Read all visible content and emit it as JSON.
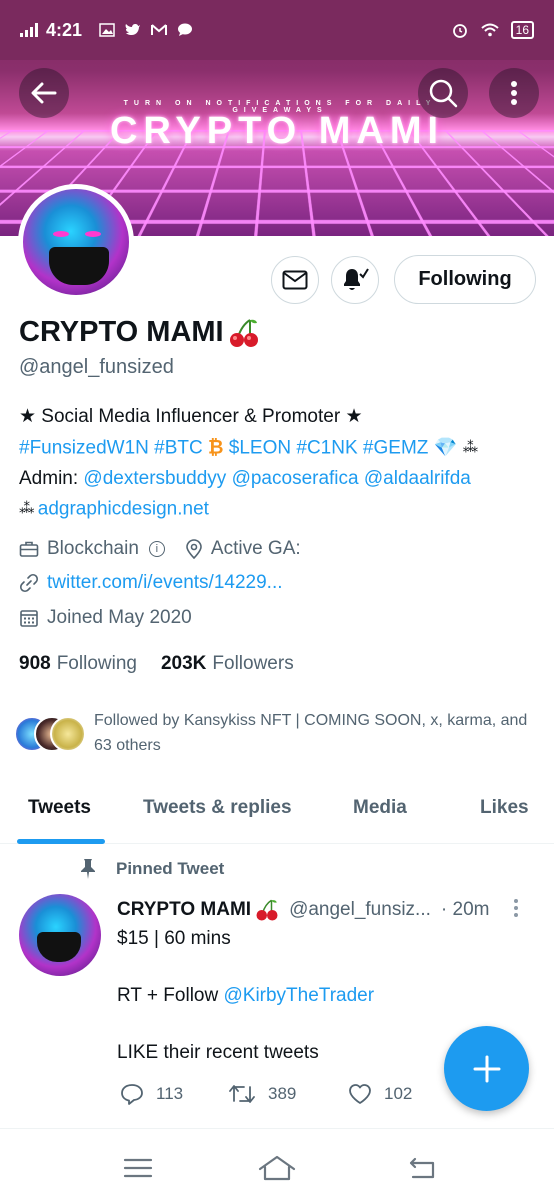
{
  "status_bar": {
    "time": "4:21",
    "battery": "16"
  },
  "banner": {
    "small_text": "TURN ON NOTIFICATIONS FOR DAILY GIVEAWAYS",
    "title": "CRYPTO MAMI"
  },
  "profile": {
    "name": "CRYPTO MAMI",
    "handle": "@angel_funsized",
    "follow_label": "Following",
    "bio_line1": "★ Social Media Influencer & Promoter ★",
    "bio_tags": [
      "#FunsizedW1N",
      "#BTC",
      "$LEON",
      "#C1NK",
      "#GEMZ"
    ],
    "bio_admin_label": "Admin:",
    "bio_admins": [
      "@dextersbuddyy",
      "@pacoserafica",
      "@aldaalrifda"
    ],
    "bio_site": "adgraphicdesign.net",
    "category": "Blockchain",
    "location": "Active GA:",
    "url": "twitter.com/i/events/14229...",
    "joined": "Joined May 2020",
    "following_count": "908",
    "following_label": "Following",
    "followers_count": "203K",
    "followers_label": "Followers",
    "followed_by": "Followed by Kansykiss NFT | COMING SOON, x, karma, and 63 others"
  },
  "tabs": [
    {
      "label": "Tweets",
      "active": true
    },
    {
      "label": "Tweets & replies",
      "active": false
    },
    {
      "label": "Media",
      "active": false
    },
    {
      "label": "Likes",
      "active": false
    }
  ],
  "tweet": {
    "pinned_label": "Pinned Tweet",
    "name": "CRYPTO MAMI",
    "handle": "@angel_funsiz...",
    "time": "· 20m",
    "line1": "$15 | 60 mins",
    "line2_prefix": "RT + Follow ",
    "line2_mention": "@KirbyTheTrader",
    "line3": "LIKE their recent tweets",
    "replies": "113",
    "retweets": "389",
    "likes": "102"
  },
  "colors": {
    "accent": "#1d9bf0",
    "secondary_text": "#536471",
    "banner_purple": "#7a2a5e"
  },
  "icons": {
    "back": "arrow-left-icon",
    "search": "search-icon",
    "more": "more-vertical-icon",
    "message": "envelope-icon",
    "notifications": "bell-icon",
    "category": "briefcase-icon",
    "location": "location-pin-icon",
    "url": "link-icon",
    "joined": "calendar-icon",
    "pin": "pin-icon",
    "reply": "reply-icon",
    "retweet": "retweet-icon",
    "like": "heart-icon",
    "compose": "plus-icon"
  }
}
